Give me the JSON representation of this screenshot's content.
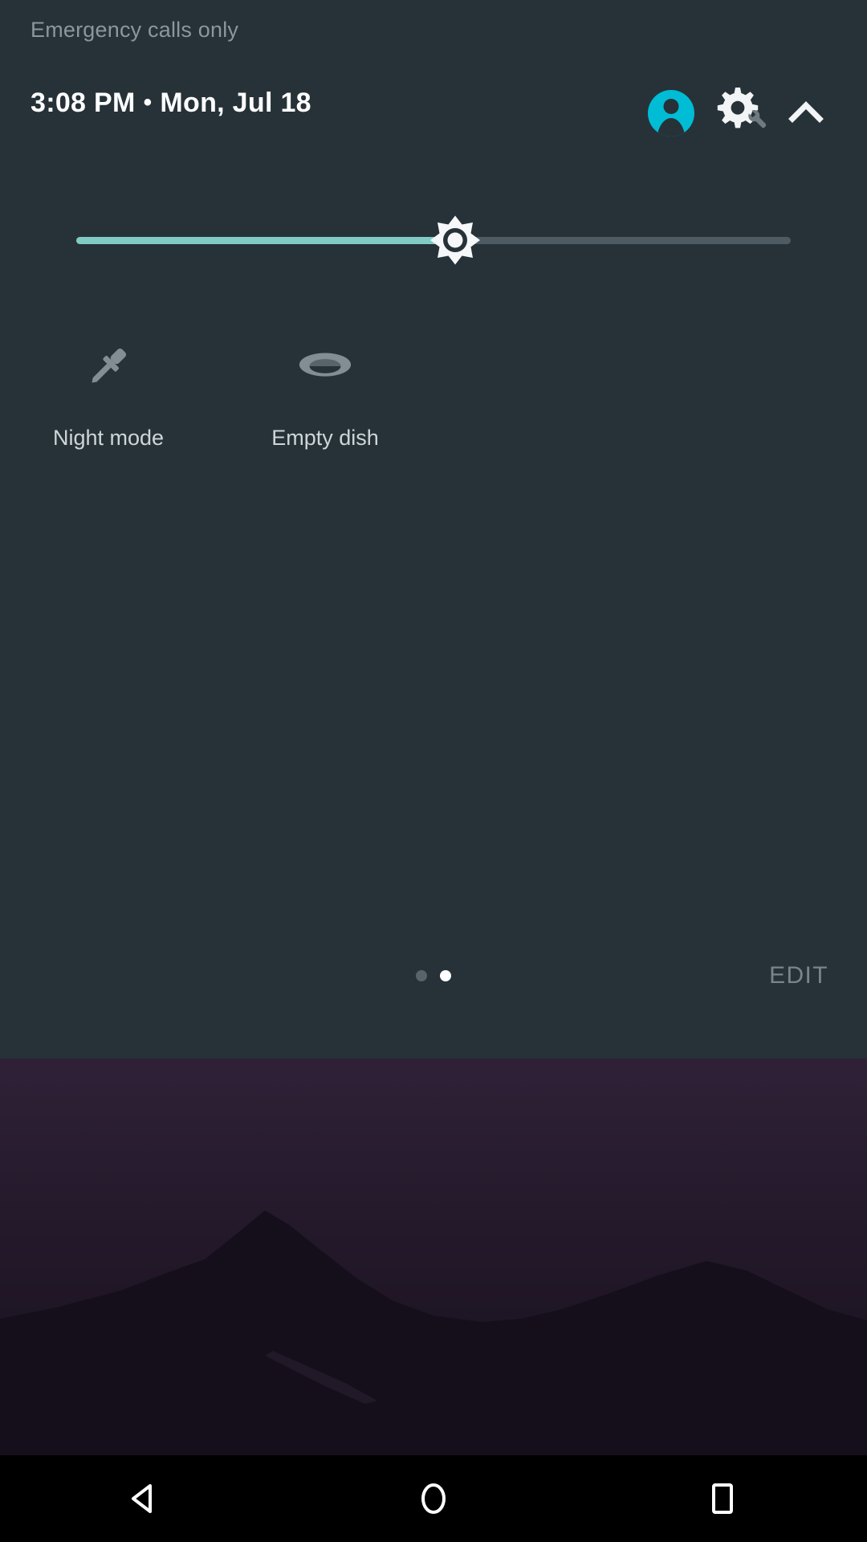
{
  "status": {
    "carrier_text": "Emergency calls only",
    "time": "3:08 PM",
    "separator": "•",
    "date": "Mon, Jul 18"
  },
  "header": {
    "avatar_icon": "user-avatar-icon",
    "settings_icon": "gear-wrench-icon",
    "collapse_icon": "chevron-up-icon",
    "accent_color": "#00BCD4"
  },
  "brightness": {
    "icon": "brightness-sun-icon",
    "fill_percent": 53,
    "fill_color": "#80CBC4",
    "track_color": "#4F5B62"
  },
  "tiles": [
    {
      "label": "Night mode",
      "icon": "eyedropper-icon",
      "state": "off"
    },
    {
      "label": "Empty dish",
      "icon": "dish-ellipse-icon",
      "state": "off"
    }
  ],
  "footer": {
    "edit_label": "EDIT",
    "pages": 2,
    "active_page": 2
  },
  "navbar": {
    "back_icon": "back-triangle-icon",
    "home_icon": "home-circle-icon",
    "recents_icon": "recents-square-icon"
  },
  "panel": {
    "background_color": "#263238"
  }
}
